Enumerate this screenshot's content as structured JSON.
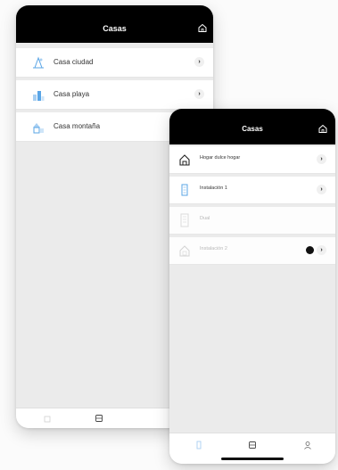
{
  "back_phone": {
    "title": "Casas",
    "items": [
      {
        "label": "Casa ciudad",
        "icon": "city-buildings-icon"
      },
      {
        "label": "Casa playa",
        "icon": "beach-buildings-icon"
      },
      {
        "label": "Casa montaña",
        "icon": "mountain-house-icon"
      }
    ],
    "chevron": "›"
  },
  "front_phone": {
    "title": "Casas",
    "items": [
      {
        "label": "Hogar dulce hogar",
        "icon": "home-outline-icon"
      },
      {
        "label": "Instalación 1",
        "icon": "building-icon"
      },
      {
        "label": "Dual",
        "icon": "tall-building-icon"
      },
      {
        "label": "Instalación 2",
        "icon": "home-faded-icon"
      }
    ],
    "chevron": "›"
  },
  "colors": {
    "header": "#000000",
    "accent": "#5aa5e6",
    "background": "#ebebeb"
  }
}
